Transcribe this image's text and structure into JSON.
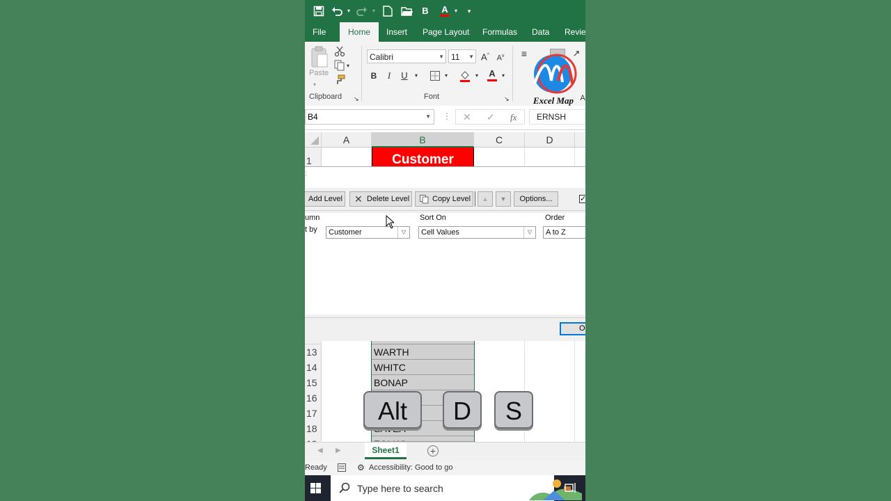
{
  "quick_access": {
    "bold": "B",
    "font_color": "A",
    "more": "▾"
  },
  "tabs": [
    "File",
    "Home",
    "Insert",
    "Page Layout",
    "Formulas",
    "Data",
    "Review"
  ],
  "ribbon": {
    "paste_label": "Paste",
    "clipboard_label": "Clipboard",
    "font_label": "Font",
    "font_name": "Calibri",
    "font_size": "11",
    "bold": "B",
    "italic": "I",
    "underline": "U",
    "grow": "A",
    "shrink": "A",
    "font_color": "A",
    "logo_text": "Excel Map",
    "logo_letters": "EM"
  },
  "formula_bar": {
    "name_box": "B4",
    "fx": "fx",
    "value": "ERNSH"
  },
  "columns": [
    "A",
    "B",
    "C",
    "D"
  ],
  "header_cell": "Customer",
  "rows_top": [
    "1"
  ],
  "dialog": {
    "add_level": "Add Level",
    "delete_level": "Delete Level",
    "copy_level": "Copy Level",
    "options": "Options...",
    "col_header": "umn",
    "sort_on_header": "Sort On",
    "order_header": "Order",
    "sort_by_label": "t by",
    "column_value": "Customer",
    "sort_on_value": "Cell Values",
    "order_value": "A to Z",
    "ok": "O"
  },
  "rows": [
    {
      "num": "13",
      "value": "WARTH"
    },
    {
      "num": "14",
      "value": "WHITC"
    },
    {
      "num": "15",
      "value": "BONAP"
    },
    {
      "num": "16",
      "value": ""
    },
    {
      "num": "17",
      "value": ""
    },
    {
      "num": "18",
      "value": "SAVEA"
    },
    {
      "num": "19",
      "value": "FOLKO"
    }
  ],
  "keys": [
    "Alt",
    "D",
    "S"
  ],
  "sheet_tab": "Sheet1",
  "status": {
    "ready": "Ready",
    "accessibility": "Accessibility: Good to go"
  },
  "taskbar": {
    "search_placeholder": "Type here to search"
  },
  "colors": {
    "excel_green": "#217346",
    "header_red": "#ff0000",
    "background": "#468259"
  }
}
